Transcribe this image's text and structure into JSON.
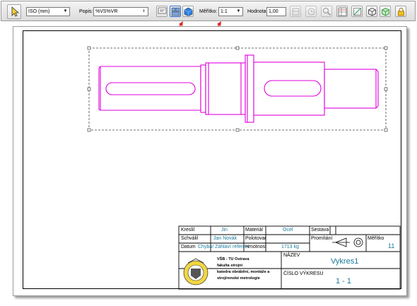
{
  "toolbar": {
    "standard_value": "ISO (mm)",
    "popis_label": "Popis:",
    "popis_value": "%VS%VR",
    "meritko_label": "Měřítko:",
    "meritko_value": "1:1",
    "hodnota_label": "Hodnota:",
    "hodnota_value": "1,00"
  },
  "title_block": {
    "kreslil_label": "Kreslil",
    "kreslil_value": "Jin",
    "schvalil_label": "Schválil",
    "schvalil_value": "Jan Novák",
    "datum_label": "Datum",
    "datum_value": "Chyba! Záhlaví referen",
    "material_label": "Materiál",
    "material_value": "Ocel",
    "polotovar_label": "Polotovar",
    "hmotnost_label": "Hmotnost",
    "hmotnost_value": "1713 kg",
    "sestava_label": "Sestava",
    "promitani_label": "Promítání",
    "meritko_label": "Měřítko",
    "meritko_value": "11",
    "nazev_label": "NÁZEV",
    "nazev_value": "Vykres1",
    "cislo_label": "ČÍSLO VÝKRESU",
    "cislo_value": "1 - 1",
    "school_line1": "VŠB - TU Ostrava",
    "school_line2": "fakulta strojní",
    "school_line3": "katedra obrábění, montáže a",
    "school_line4": "strojírenské metrologie"
  },
  "colors": {
    "part": "#e000e0",
    "arrow": "#e02020",
    "accent_text": "#1a7a9a"
  }
}
